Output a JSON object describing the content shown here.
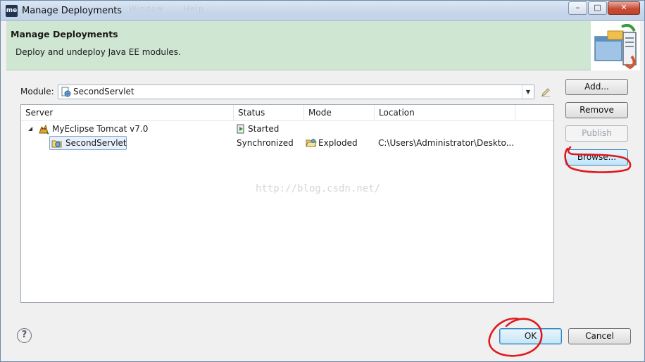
{
  "window": {
    "title": "Manage Deployments",
    "app_icon": "me",
    "ghost_menu": [
      "...",
      "Window",
      "Help"
    ],
    "controls": {
      "minimize": "–",
      "maximize": "□",
      "close": "✕"
    }
  },
  "header": {
    "title": "Manage Deployments",
    "description": "Deploy and undeploy Java EE modules.",
    "image_icon": "deploy-wizard-icon"
  },
  "module": {
    "label": "Module:",
    "value": "SecondServlet",
    "icon": "web-module-icon"
  },
  "table": {
    "columns": [
      "Server",
      "Status",
      "Mode",
      "Location"
    ],
    "rows": [
      {
        "server": "MyEclipse Tomcat v7.0",
        "status": "Started",
        "mode": "",
        "location": "",
        "expanded": true,
        "icon": "tomcat-server-icon",
        "status_icon": "started-icon"
      },
      {
        "server": "SecondServlet",
        "status": "Synchronized",
        "mode": "Exploded",
        "location": "C:\\Users\\Administrator\\Deskto...",
        "selected": true,
        "icon": "web-module-icon",
        "mode_icon": "exploded-folder-icon"
      }
    ]
  },
  "watermark": "http://blog.csdn.net/",
  "buttons": {
    "add": "Add...",
    "remove": "Remove",
    "publish": "Publish",
    "browse": "Browse...",
    "ok": "OK",
    "cancel": "Cancel",
    "help": "?"
  },
  "states": {
    "publish_enabled": false,
    "browse_focused": true,
    "ok_default": true
  },
  "annotation_color": "#e0191f"
}
